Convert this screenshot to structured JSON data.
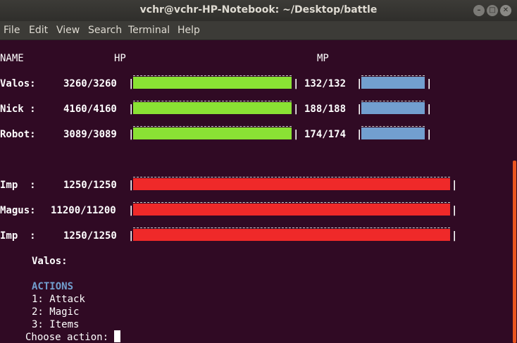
{
  "window": {
    "title": "vchr@vchr-HP-Notebook: ~/Desktop/battle"
  },
  "menu": [
    "File",
    "Edit",
    "View",
    "Search",
    "Terminal",
    "Help"
  ],
  "headers": {
    "name": "NAME",
    "hp": "HP",
    "mp": "MP"
  },
  "party": [
    {
      "name": "Valos:",
      "hp_text": "3260/3260",
      "hp_fraction": 1.0,
      "mp_text": "132/132",
      "mp_fraction": 1.0
    },
    {
      "name": "Nick :",
      "hp_text": "4160/4160",
      "hp_fraction": 1.0,
      "mp_text": "188/188",
      "mp_fraction": 1.0
    },
    {
      "name": "Robot:",
      "hp_text": "3089/3089",
      "hp_fraction": 1.0,
      "mp_text": "174/174",
      "mp_fraction": 1.0
    }
  ],
  "enemies": [
    {
      "name": "Imp  :",
      "hp_text": "1250/1250",
      "hp_fraction": 1.0
    },
    {
      "name": "Magus:",
      "hp_text": "11200/11200",
      "hp_fraction": 1.0
    },
    {
      "name": "Imp  :",
      "hp_text": "1250/1250",
      "hp_fraction": 1.0
    }
  ],
  "turn": {
    "current_character": "Valos:",
    "actions_heading": "ACTIONS",
    "actions": [
      "1: Attack",
      "2: Magic",
      "3: Items"
    ],
    "prompt": "Choose action:"
  },
  "colors": {
    "hp": "#8ae234",
    "mp": "#729fcf",
    "enemy_hp": "#ef2929",
    "background": "#300a24"
  },
  "icons": [
    "minimize-icon",
    "maximize-icon",
    "close-icon"
  ]
}
